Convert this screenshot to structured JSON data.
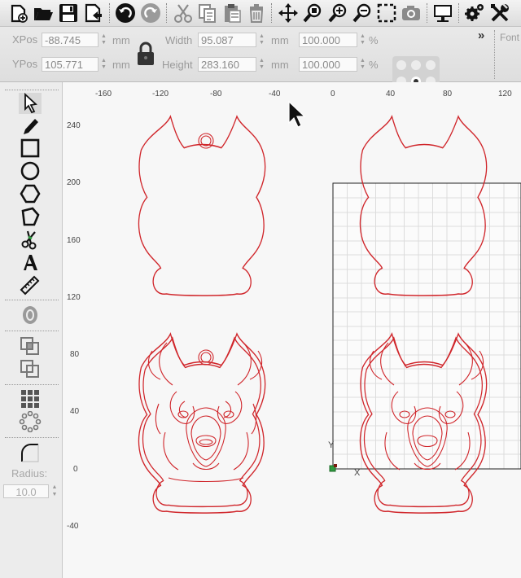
{
  "toolbar": {
    "buttons": [
      {
        "name": "new-icon"
      },
      {
        "name": "open-folder-icon"
      },
      {
        "name": "save-icon"
      },
      {
        "name": "export-icon"
      },
      {
        "name": "undo-icon"
      },
      {
        "name": "redo-icon"
      },
      {
        "name": "cut-icon"
      },
      {
        "name": "copy-icon"
      },
      {
        "name": "paste-icon"
      },
      {
        "name": "delete-icon"
      },
      {
        "name": "move-icon"
      },
      {
        "name": "zoom-selection-icon"
      },
      {
        "name": "zoom-in-icon"
      },
      {
        "name": "zoom-out-icon"
      },
      {
        "name": "frame-icon"
      },
      {
        "name": "camera-icon"
      },
      {
        "name": "monitor-icon"
      },
      {
        "name": "settings-icon"
      },
      {
        "name": "tools-icon"
      }
    ]
  },
  "properties": {
    "xpos_label": "XPos",
    "xpos_value": "-88.745",
    "ypos_label": "YPos",
    "ypos_value": "105.771",
    "width_label": "Width",
    "width_value": "95.087",
    "height_label": "Height",
    "height_value": "283.160",
    "width_percent": "100.000",
    "height_percent": "100.000",
    "unit_mm": "mm",
    "unit_percent": "%",
    "overflow_chevron": "»",
    "font_label": "Font"
  },
  "left_tools": {
    "radius_label": "Radius:",
    "radius_value": "10.0"
  },
  "canvas": {
    "x_ticks": [
      "-160",
      "-120",
      "-80",
      "-40",
      "0",
      "40",
      "80",
      "120"
    ],
    "y_ticks": [
      "240",
      "200",
      "160",
      "120",
      "80",
      "40",
      "0",
      "-40"
    ],
    "axis_x_label": "X",
    "axis_y_label": "Y"
  },
  "colors": {
    "cut_line": "#d0262b",
    "grid": "#d8d8d8",
    "accent_green": "#2f9a3f"
  }
}
